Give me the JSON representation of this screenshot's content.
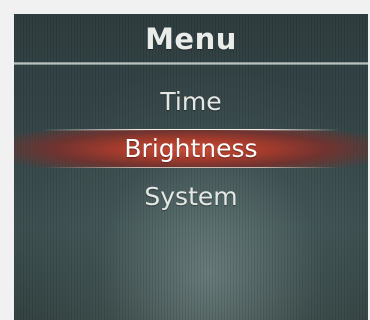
{
  "menu": {
    "title": "Menu",
    "items": [
      {
        "label": "Time",
        "selected": false
      },
      {
        "label": "Brightness",
        "selected": true
      },
      {
        "label": "System",
        "selected": false
      }
    ]
  },
  "colors": {
    "background": "#334446",
    "text": "#e3e8e4",
    "selection_highlight": "#b8412f"
  }
}
